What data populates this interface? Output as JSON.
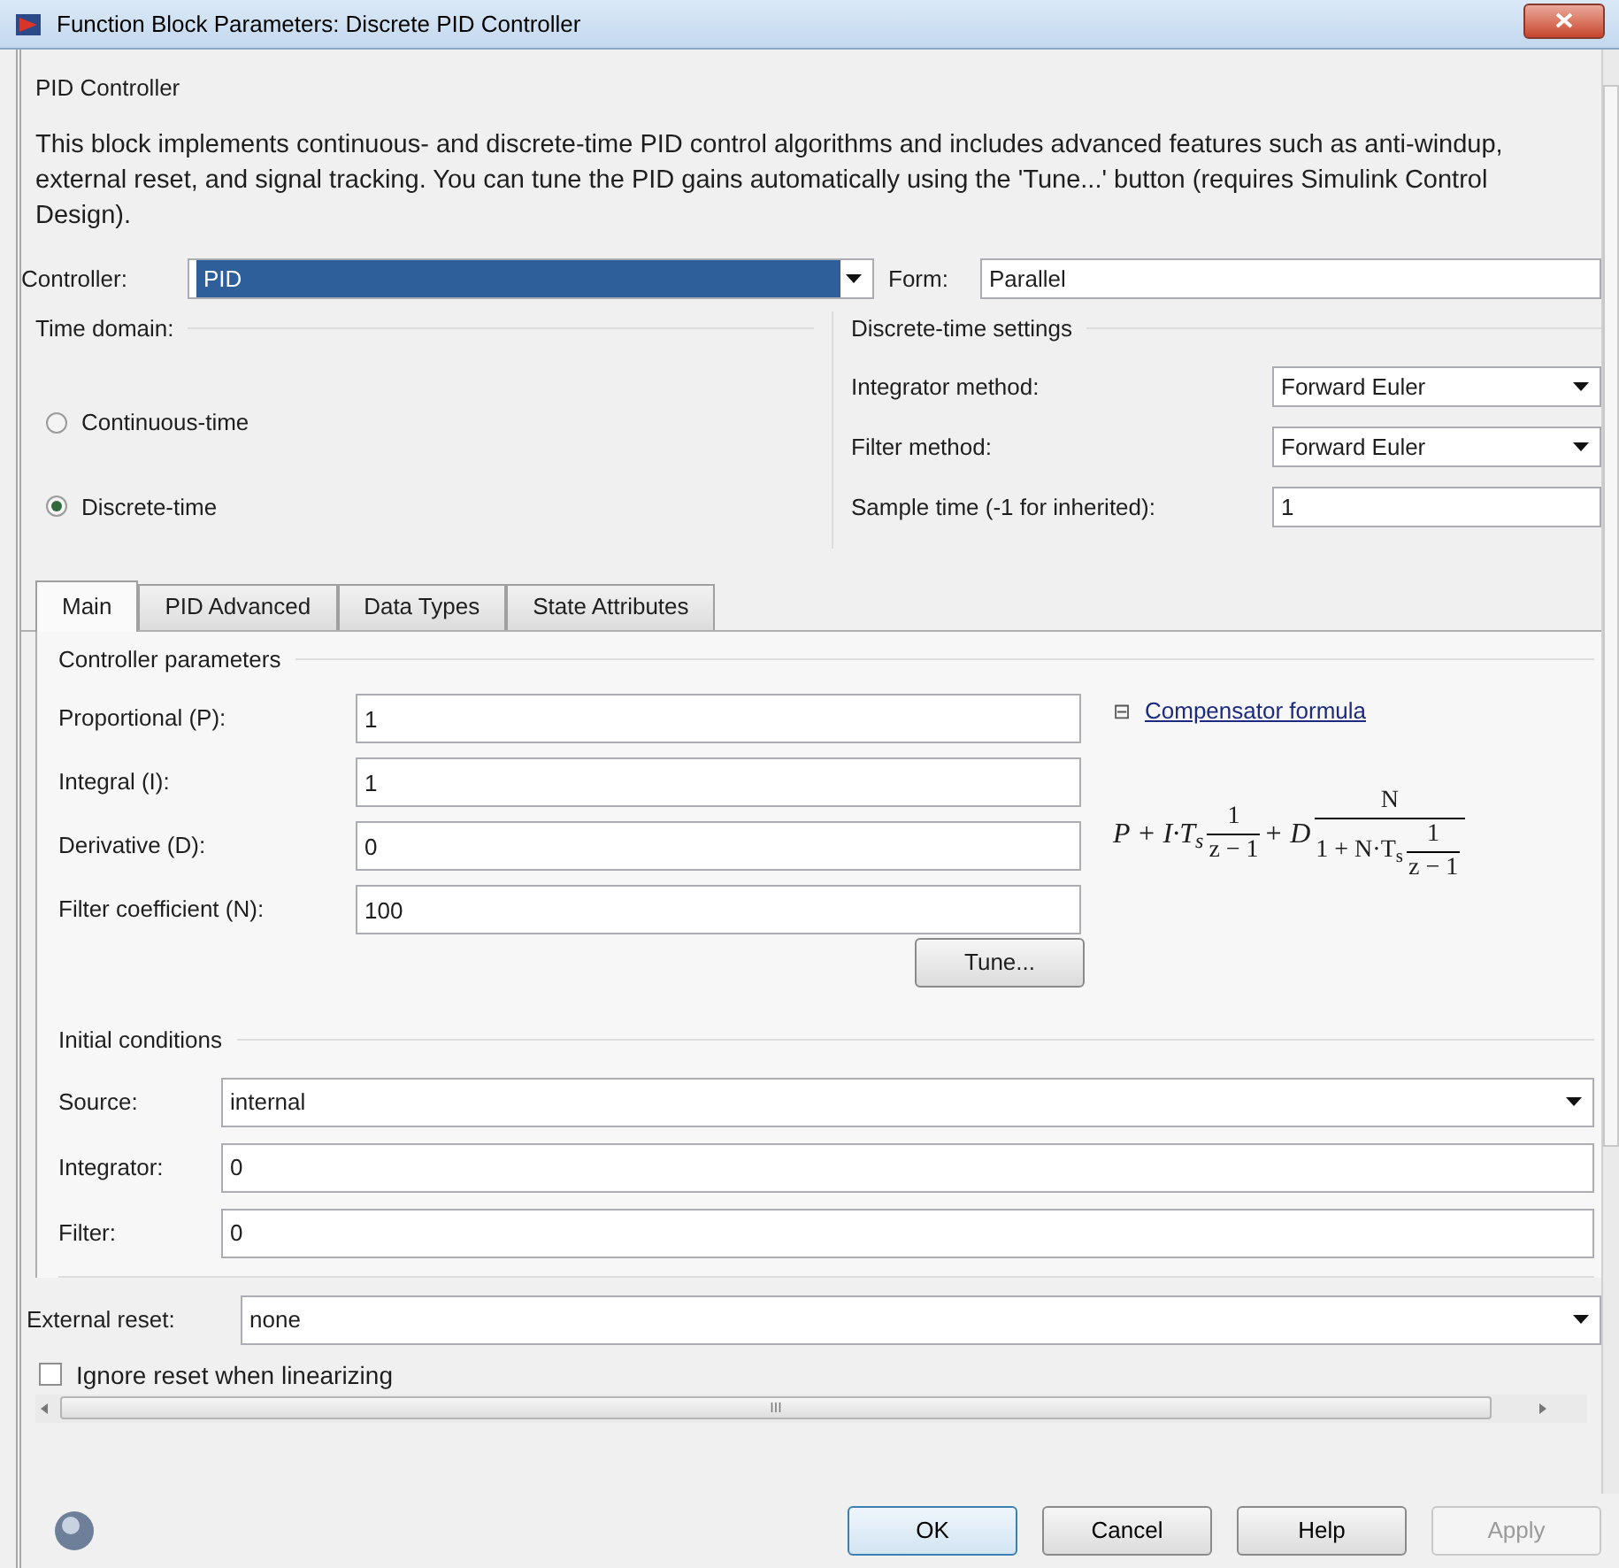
{
  "window": {
    "title": "Function Block Parameters: Discrete PID Controller"
  },
  "block_name": "PID Controller",
  "description": "This block implements continuous- and discrete-time PID control algorithms and includes advanced features such as anti-windup, external reset, and signal tracking. You can tune the PID gains automatically using the 'Tune...' button (requires Simulink Control Design).",
  "controller": {
    "label": "Controller:",
    "value": "PID",
    "focused": true
  },
  "form": {
    "label": "Form:",
    "value": "Parallel"
  },
  "time_domain": {
    "title": "Time domain:",
    "options": [
      {
        "label": "Continuous-time",
        "selected": false
      },
      {
        "label": "Discrete-time",
        "selected": true
      }
    ]
  },
  "discrete_settings": {
    "title": "Discrete-time settings",
    "rows": [
      {
        "kind": "dropdown",
        "label": "Integrator method:",
        "value": "Forward Euler"
      },
      {
        "kind": "dropdown",
        "label": "Filter method:",
        "value": "Forward Euler"
      },
      {
        "kind": "text",
        "label": "Sample time (-1 for inherited):",
        "value": "1"
      }
    ]
  },
  "tabs": [
    {
      "label": "Main",
      "selected": true
    },
    {
      "label": "PID Advanced",
      "selected": false
    },
    {
      "label": "Data Types",
      "selected": false
    },
    {
      "label": "State Attributes",
      "selected": false
    }
  ],
  "controller_parameters": {
    "title": "Controller parameters",
    "rows": [
      {
        "label": "Proportional (P):",
        "value": "1"
      },
      {
        "label": "Integral (I):",
        "value": "1"
      },
      {
        "label": "Derivative (D):",
        "value": "0"
      },
      {
        "label": "Filter coefficient (N):",
        "value": "100"
      }
    ],
    "tune_button": "Tune...",
    "formula_toggle": {
      "symbol": "⊟",
      "expanded": true
    },
    "formula_link": "Compensator formula",
    "formula": {
      "term1": "P + I·T$_{s}$",
      "frac1": {
        "num": "1",
        "den": "z − 1"
      },
      "term2": "+ D",
      "frac2": {
        "num": "N",
        "den": "1 + N·T$_{s}$",
        "den_frac": {
          "num": "1",
          "den": "z − 1"
        }
      }
    }
  },
  "initial_conditions": {
    "title": "Initial conditions",
    "rows": [
      {
        "kind": "dropdown",
        "label": "Source:",
        "value": "internal"
      },
      {
        "kind": "text",
        "label": "Integrator:",
        "value": "0"
      },
      {
        "kind": "text",
        "label": "Filter:",
        "value": "0"
      }
    ]
  },
  "external_reset": {
    "label": "External reset:",
    "value": "none"
  },
  "ignore_reset": {
    "label": "Ignore reset when linearizing",
    "checked": false
  },
  "hscroll_grip": "III",
  "buttons": [
    {
      "label": "OK",
      "disabled": false,
      "default": true
    },
    {
      "label": "Cancel",
      "disabled": false,
      "default": false
    },
    {
      "label": "Help",
      "disabled": false,
      "default": false
    },
    {
      "label": "Apply",
      "disabled": true,
      "default": false
    }
  ]
}
